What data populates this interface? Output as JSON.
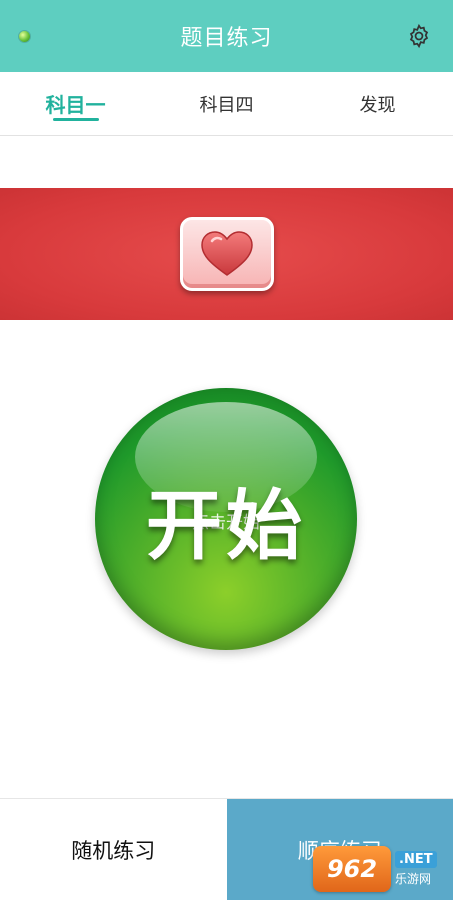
{
  "header": {
    "title": "题目练习",
    "status_icon": "status-dot-icon",
    "settings_icon": "gear-icon"
  },
  "tabs": [
    {
      "label": "科目一",
      "active": true
    },
    {
      "label": "科目四",
      "active": false
    },
    {
      "label": "发现",
      "active": false
    }
  ],
  "banner": {
    "icon": "heart-icon",
    "color": "#de3b3d"
  },
  "start": {
    "main_label": "开始",
    "sub_label": "点击开始"
  },
  "bottom": {
    "random_label": "随机练习",
    "order_label": "顺序练习"
  },
  "watermark": {
    "logo_text": "962",
    "net_text": ".NET",
    "cn_text": "乐游网"
  },
  "colors": {
    "header": "#5ecec0",
    "accent": "#21b29d",
    "order_button": "#5ba9c9"
  }
}
